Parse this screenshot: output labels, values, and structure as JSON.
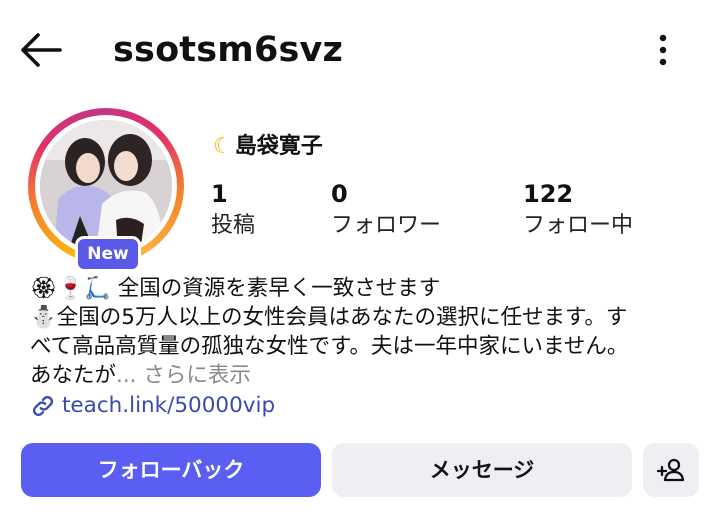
{
  "header": {
    "username": "ssotsm6svz"
  },
  "profile": {
    "display_name": "島袋寛子",
    "name_prefix_icon": "crescent-moon-icon",
    "new_badge": "New",
    "stats": [
      {
        "value": "1",
        "label": "投稿"
      },
      {
        "value": "0",
        "label": "フォロワー"
      },
      {
        "value": "122",
        "label": "フォロー中"
      }
    ]
  },
  "bio": {
    "line1_emoji": "🏵🍷🛴",
    "line1": "全国の資源を素早く一致させます",
    "line2_emoji": "⛄",
    "line2": "全国の5万人以上の女性会員はあなたの選択に任せます。す",
    "line3": "べて高品高質量の孤独な女性です。夫は一年中家にいません。",
    "line4": "あなたが",
    "more": "... さらに表示"
  },
  "link": {
    "icon": "link-icon",
    "text": "teach.link/50000vip"
  },
  "actions": {
    "follow_back": "フォローバック",
    "message": "メッセージ",
    "add_friend_icon": "add-person-icon"
  },
  "colors": {
    "primary_button": "#5b5ef2",
    "secondary_button": "#efeff3",
    "link": "#3a4bb0",
    "new_badge": "#5a59e8"
  }
}
